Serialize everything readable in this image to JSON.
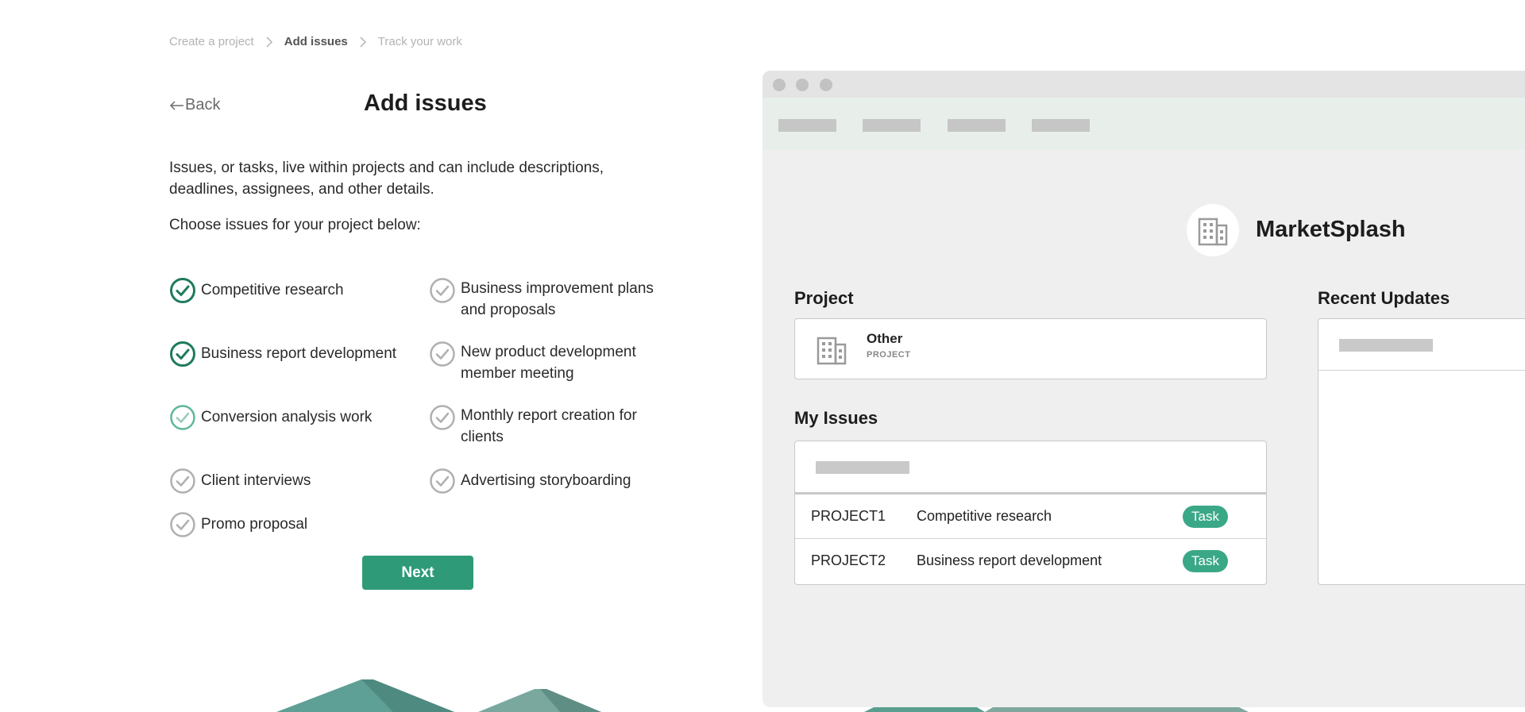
{
  "breadcrumb": {
    "items": [
      {
        "label": "Create a project"
      },
      {
        "label": "Add issues"
      },
      {
        "label": "Track your work"
      }
    ]
  },
  "header": {
    "back_label": "Back",
    "title": "Add issues"
  },
  "content": {
    "description": "Issues, or tasks, live within projects and can include descriptions, deadlines, assignees, and other details.",
    "choose_prompt": "Choose issues for your project below:"
  },
  "issues": [
    {
      "label": "Competitive research",
      "state": "checked"
    },
    {
      "label": "Business improvement plans and proposals",
      "state": "unchecked"
    },
    {
      "label": "Business report development",
      "state": "checked"
    },
    {
      "label": "New product development member meeting",
      "state": "unchecked"
    },
    {
      "label": "Conversion analysis work",
      "state": "hover"
    },
    {
      "label": "Monthly report creation for clients",
      "state": "unchecked"
    },
    {
      "label": "Client interviews",
      "state": "unchecked"
    },
    {
      "label": "Advertising storyboarding",
      "state": "unchecked"
    },
    {
      "label": "Promo proposal",
      "state": "unchecked"
    }
  ],
  "next_label": "Next",
  "preview": {
    "company_name": "MarketSplash",
    "company_icon": "building-icon",
    "project_heading": "Project",
    "project_card": {
      "name": "Other",
      "type": "PROJECT",
      "icon": "building-icon"
    },
    "my_issues_heading": "My Issues",
    "issue_rows": [
      {
        "key": "PROJECT1",
        "summary": "Competitive research",
        "type": "Task"
      },
      {
        "key": "PROJECT2",
        "summary": "Business report development",
        "type": "Task"
      }
    ],
    "recent_updates_heading": "Recent Updates"
  },
  "colors": {
    "accent": "#2e9a78",
    "checked": "#1f7a5e",
    "hover": "#5fb79b",
    "unchecked": "#b0b0b0",
    "badge": "#3aa886"
  }
}
